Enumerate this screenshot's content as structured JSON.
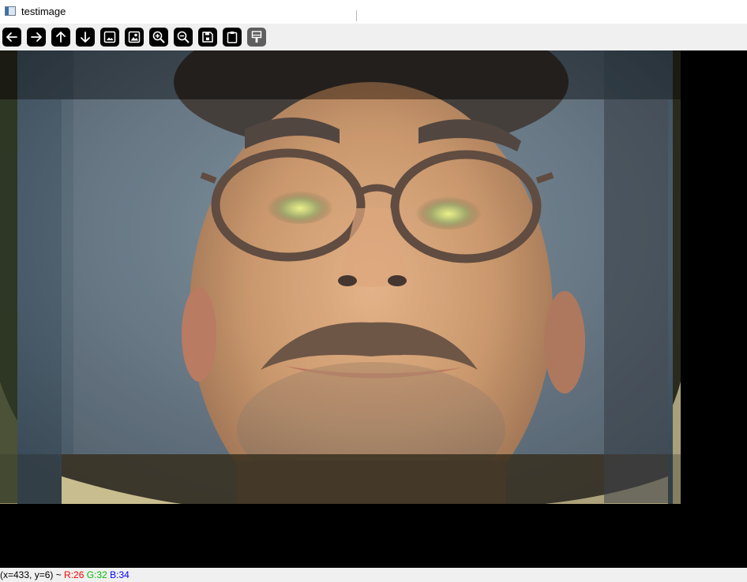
{
  "window": {
    "title": "testimage",
    "app_icon": "image-window-icon"
  },
  "toolbar": {
    "buttons": [
      {
        "name": "pan-left",
        "icon": "arrow-left-icon"
      },
      {
        "name": "pan-right",
        "icon": "arrow-right-icon"
      },
      {
        "name": "pan-up",
        "icon": "arrow-up-icon"
      },
      {
        "name": "pan-down",
        "icon": "arrow-down-icon"
      },
      {
        "name": "zoom-original",
        "icon": "image-icon"
      },
      {
        "name": "zoom-fit",
        "icon": "image-fit-icon"
      },
      {
        "name": "zoom-in",
        "icon": "zoom-in-icon"
      },
      {
        "name": "zoom-out",
        "icon": "zoom-out-icon"
      },
      {
        "name": "save-image",
        "icon": "save-icon"
      },
      {
        "name": "copy-clipboard",
        "icon": "clipboard-icon"
      },
      {
        "name": "properties",
        "icon": "paint-brush-icon",
        "active": true
      }
    ]
  },
  "image": {
    "description_colors": {
      "background": "#000000",
      "skin": "#c08a58",
      "wall": "#5a6f80",
      "frame_tint": "#8a8560"
    }
  },
  "status": {
    "coords": "(x=433, y=6) ~ ",
    "r": "R:26",
    "g": "G:32",
    "b": "B:34",
    "r_color": "#ff0000",
    "g_color": "#00c000",
    "b_color": "#0000ff"
  }
}
